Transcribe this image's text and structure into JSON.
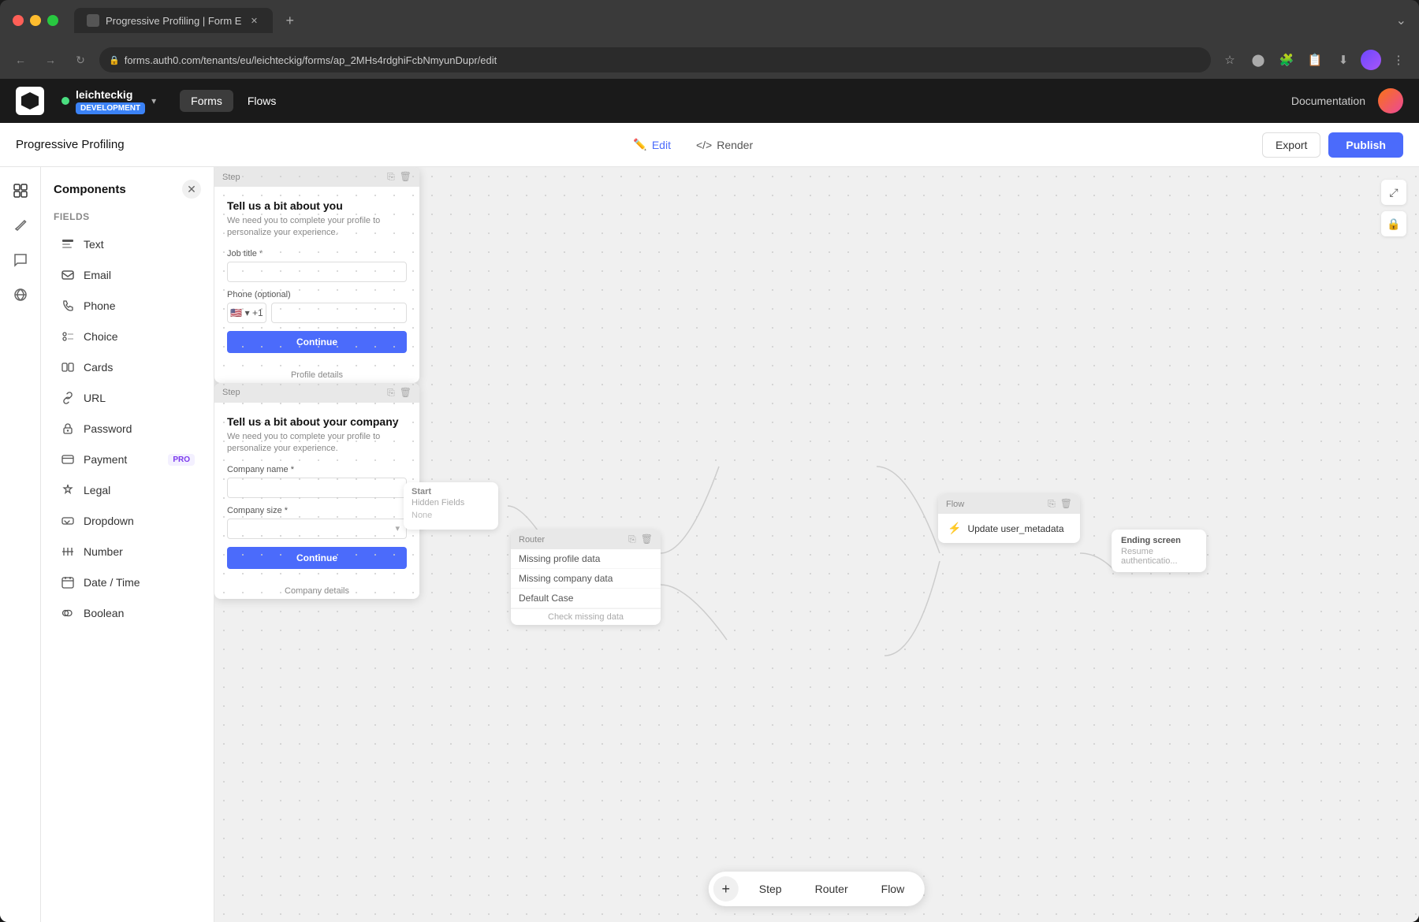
{
  "browser": {
    "tab_title": "Progressive Profiling | Form E",
    "url": "forms.auth0.com/tenants/eu/leichteckig/forms/ap_2MHs4rdghiFcbNmyunDupr/edit",
    "new_tab_label": "+"
  },
  "app_header": {
    "tenant_name": "leichteckig",
    "tenant_env": "DEVELOPMENT",
    "nav_items": [
      "Forms",
      "Flows"
    ],
    "doc_link": "Documentation"
  },
  "toolbar": {
    "form_title": "Progressive Profiling",
    "edit_label": "Edit",
    "render_label": "Render",
    "export_label": "Export",
    "publish_label": "Publish"
  },
  "components_panel": {
    "title": "Components",
    "section_title": "Fields",
    "items": [
      {
        "icon": "doc-icon",
        "label": "Text"
      },
      {
        "icon": "email-icon",
        "label": "Email"
      },
      {
        "icon": "phone-icon",
        "label": "Phone"
      },
      {
        "icon": "choice-icon",
        "label": "Choice"
      },
      {
        "icon": "cards-icon",
        "label": "Cards"
      },
      {
        "icon": "url-icon",
        "label": "URL"
      },
      {
        "icon": "password-icon",
        "label": "Password"
      },
      {
        "icon": "payment-icon",
        "label": "Payment",
        "badge": "PRO"
      },
      {
        "icon": "legal-icon",
        "label": "Legal"
      },
      {
        "icon": "dropdown-icon",
        "label": "Dropdown"
      },
      {
        "icon": "number-icon",
        "label": "Number"
      },
      {
        "icon": "datetime-icon",
        "label": "Date / Time"
      },
      {
        "icon": "boolean-icon",
        "label": "Boolean"
      }
    ]
  },
  "canvas": {
    "start_node": {
      "label": "Start",
      "field_label": "Hidden Fields",
      "field_value": "None"
    },
    "router_node": {
      "label": "Router",
      "cases": [
        "Missing profile data",
        "Missing company data",
        "Default Case"
      ],
      "footer": "Check missing data"
    },
    "profile_step": {
      "label": "Step",
      "title": "Tell us a bit about you",
      "subtitle": "We need you to complete your profile to personalize your experience.",
      "field1_label": "Job title *",
      "field2_label": "Phone (optional)",
      "flag": "🇺🇸",
      "phone_prefix": "+1",
      "continue_btn": "Continue",
      "node_label": "Profile details"
    },
    "company_step": {
      "label": "Step",
      "title": "Tell us a bit about your company",
      "subtitle": "We need you to complete your profile to personalize your experience.",
      "field1_label": "Company name *",
      "field2_label": "Company size *",
      "continue_btn": "Continue",
      "node_label": "Company details"
    },
    "flow_node": {
      "label": "Flow",
      "action": "Update user_metadata"
    },
    "ending_node": {
      "label": "Ending screen",
      "sub_label": "Resume authenticatio..."
    }
  },
  "bottom_toolbar": {
    "add_icon": "+",
    "step_label": "Step",
    "router_label": "Router",
    "flow_label": "Flow"
  },
  "canvas_controls": {
    "fullscreen_icon": "⤢",
    "lock_icon": "🔒"
  }
}
